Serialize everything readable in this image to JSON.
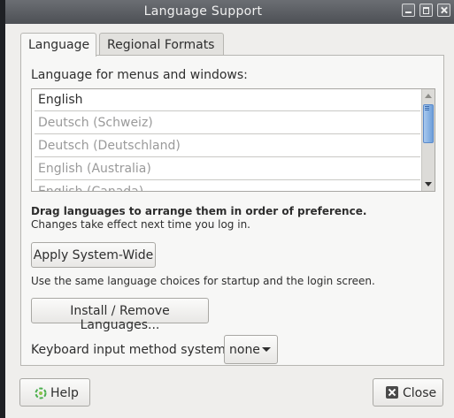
{
  "window": {
    "title": "Language Support"
  },
  "tabs": [
    {
      "label": "Language"
    },
    {
      "label": "Regional Formats"
    }
  ],
  "language": {
    "menus_label": "Language for menus and windows:",
    "languages": [
      "English",
      "Deutsch (Schweiz)",
      "Deutsch (Deutschland)",
      "English (Australia)",
      "English (Canada)"
    ],
    "drag_hint": "Drag languages to arrange them in order of preference.",
    "effect_note": "Changes take effect next time you log in.",
    "apply_label": "Apply System-Wide",
    "apply_note": "Use the same language choices for startup and the login screen.",
    "install_label": "Install / Remove Languages...",
    "keyboard_label": "Keyboard input method system:",
    "keyboard_value": "none"
  },
  "footer": {
    "help_label": "Help",
    "close_label": "Close"
  },
  "colors": {
    "titlebar": "#5c5f64",
    "scroll_thumb": "#6e9fda",
    "window_bg": "#efeeec"
  }
}
